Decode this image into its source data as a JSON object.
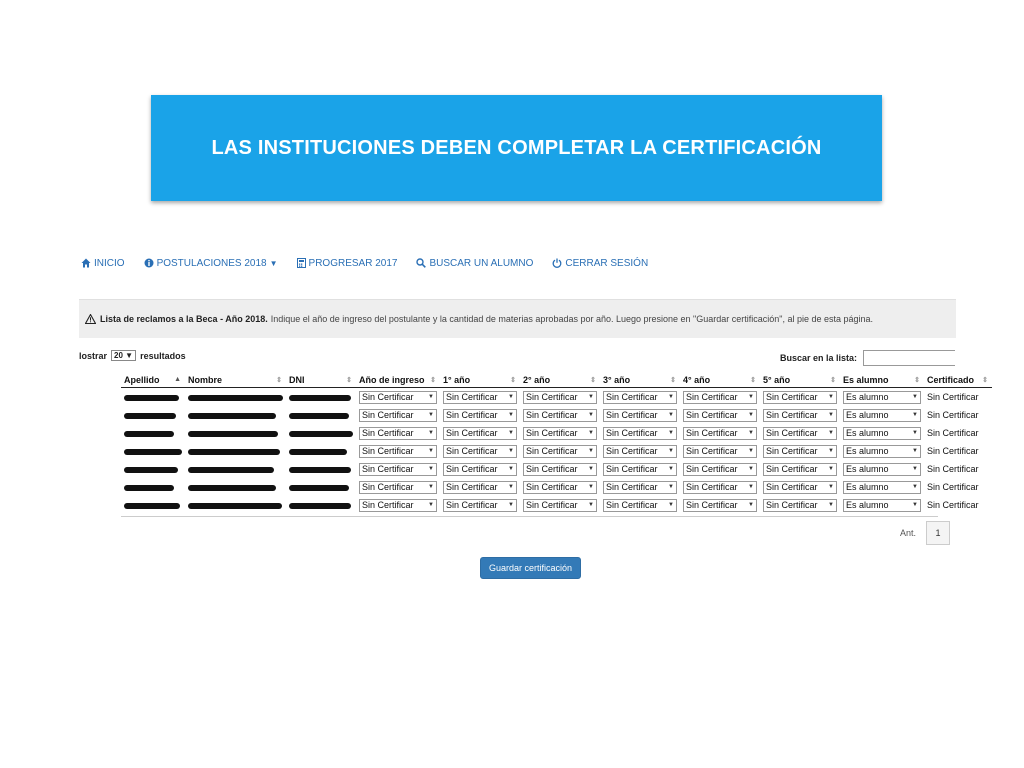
{
  "banner": {
    "title": "LAS INSTITUCIONES DEBEN COMPLETAR LA CERTIFICACIÓN"
  },
  "nav": {
    "inicio": "INICIO",
    "postulaciones": "POSTULACIONES 2018",
    "progresar": "PROGRESAR 2017",
    "buscar": "BUSCAR UN ALUMNO",
    "cerrar": "CERRAR SESIÓN"
  },
  "alert": {
    "strong": "Lista de reclamos a la Beca - Año 2018.",
    "text": "Indique el año de ingreso del postulante y la cantidad de materias aprobadas por año. Luego presione en \"Guardar certificación\", al pie de esta página."
  },
  "listing": {
    "show_prefix": "lostrar",
    "page_size": "20",
    "show_suffix": "resultados"
  },
  "search": {
    "label": "Buscar en la lista:"
  },
  "table": {
    "headers": [
      "Apellido",
      "Nombre",
      "DNI",
      "Año de ingreso",
      "1° año",
      "2° año",
      "3° año",
      "4° año",
      "5° año",
      "Es alumno",
      "Certificado"
    ],
    "rows": [
      {
        "select": "Sin Certificar",
        "alumno": "Es alumno",
        "cert": "Sin Certificar"
      },
      {
        "select": "Sin Certificar",
        "alumno": "Es alumno",
        "cert": "Sin Certificar"
      },
      {
        "select": "Sin Certificar",
        "alumno": "Es alumno",
        "cert": "Sin Certificar"
      },
      {
        "select": "Sin Certificar",
        "alumno": "Es alumno",
        "cert": "Sin Certificar"
      },
      {
        "select": "Sin Certificar",
        "alumno": "Es alumno",
        "cert": "Sin Certificar"
      },
      {
        "select": "Sin Certificar",
        "alumno": "Es alumno",
        "cert": "Sin Certificar"
      },
      {
        "select": "Sin Certificar",
        "alumno": "Es alumno",
        "cert": "Sin Certificar"
      }
    ]
  },
  "pager": {
    "prev": "Ant.",
    "page": "1"
  },
  "actions": {
    "save": "Guardar certificación"
  },
  "colors": {
    "banner": "#1aa3e8",
    "link": "#2a6fb5",
    "primary": "#337ab7"
  }
}
